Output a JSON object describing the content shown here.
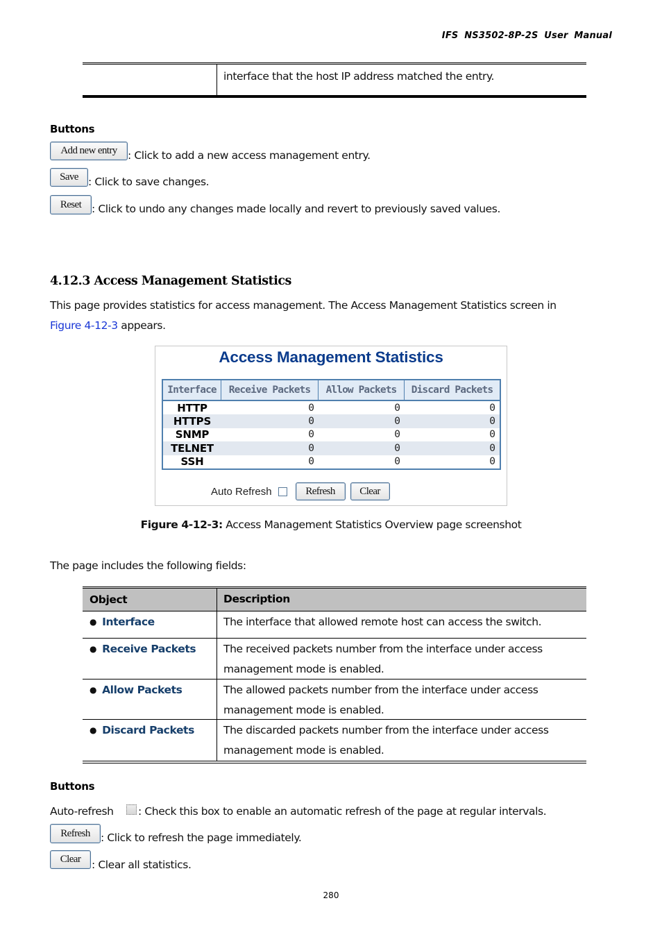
{
  "header": {
    "manual_title": "IFS  NS3502-8P-2S  User  Manual"
  },
  "top_table": {
    "description": "interface that the host IP address matched the entry."
  },
  "buttons_section_1": {
    "label": "Buttons",
    "items": [
      {
        "button": "Add new entry",
        "description": ": Click to add a new access management entry."
      },
      {
        "button": "Save",
        "description": ": Click to save changes."
      },
      {
        "button": "Reset",
        "description": ": Click to undo any changes made locally and revert to previously saved values."
      }
    ]
  },
  "section": {
    "title": "4.12.3 Access Management Statistics",
    "intro_line1": "This page provides statistics for access management. The Access Management Statistics screen in",
    "intro_link": "Figure 4-12-3",
    "intro_line2_rest": " appears."
  },
  "figure": {
    "title": "Access Management Statistics",
    "columns": [
      "Interface",
      "Receive Packets",
      "Allow Packets",
      "Discard Packets"
    ],
    "rows": [
      {
        "interface": "HTTP",
        "receive": "0",
        "allow": "0",
        "discard": "0"
      },
      {
        "interface": "HTTPS",
        "receive": "0",
        "allow": "0",
        "discard": "0"
      },
      {
        "interface": "SNMP",
        "receive": "0",
        "allow": "0",
        "discard": "0"
      },
      {
        "interface": "TELNET",
        "receive": "0",
        "allow": "0",
        "discard": "0"
      },
      {
        "interface": "SSH",
        "receive": "0",
        "allow": "0",
        "discard": "0"
      }
    ],
    "auto_refresh_label": "Auto Refresh",
    "auto_refresh_checked": false,
    "refresh_button": "Refresh",
    "clear_button": "Clear"
  },
  "caption": {
    "label": "Figure 4-12-3:",
    "text": " Access Management Statistics Overview page screenshot"
  },
  "fields_intro": "The page includes the following fields:",
  "fields_table": {
    "headers": [
      "Object",
      "Description"
    ],
    "rows": [
      {
        "object": "Interface",
        "description": [
          "The interface that allowed remote host can access the switch."
        ]
      },
      {
        "object": "Receive Packets",
        "description": [
          "The received packets number from the interface under access",
          "management mode is enabled."
        ]
      },
      {
        "object": "Allow Packets",
        "description": [
          "The allowed packets number from the interface under access",
          "management mode is enabled."
        ]
      },
      {
        "object": "Discard Packets",
        "description": [
          "The discarded packets number from the interface under access",
          "management mode is enabled."
        ]
      }
    ]
  },
  "buttons_section_2": {
    "label": "Buttons",
    "auto_refresh_prefix": "Auto-refresh",
    "auto_refresh_desc": ": Check this box to enable an automatic refresh of the page at regular intervals.",
    "items": [
      {
        "button": "Refresh",
        "description": ": Click to refresh the page immediately."
      },
      {
        "button": "Clear",
        "description": ": Clear all statistics."
      }
    ]
  },
  "page_number": "280"
}
